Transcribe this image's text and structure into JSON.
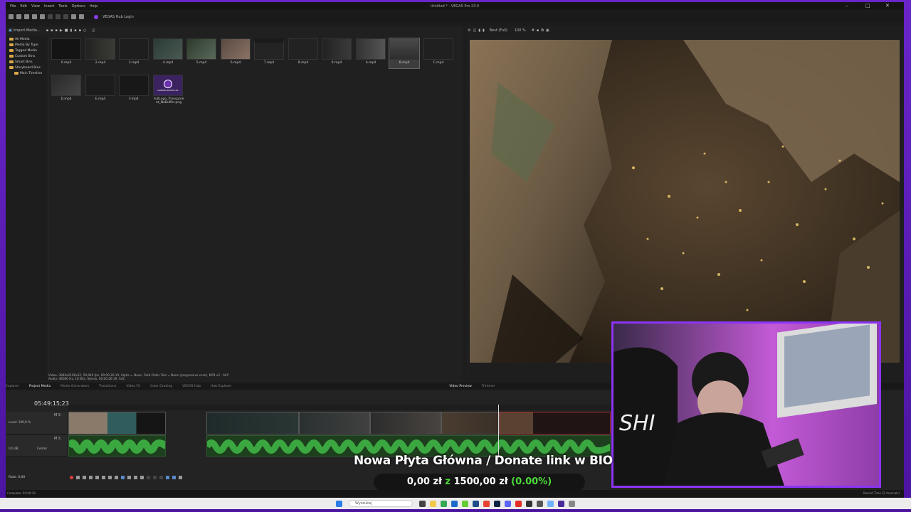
{
  "menu": {
    "items": [
      "File",
      "Edit",
      "View",
      "Insert",
      "Tools",
      "Options",
      "Help"
    ],
    "window_title": "Untitled * - VEGAS Pro 23.0",
    "hub_login": "VEGAS Hub Login"
  },
  "explorer": {
    "import_label": "Import Media...",
    "tree": [
      "All Media",
      "Media By Type",
      "Tagged Media",
      "Custom Bins",
      "Smart Bins",
      "Storyboard Bins",
      "Main Timeline"
    ],
    "media": [
      "0.mp4",
      "2.mp4",
      "3.mp4",
      "4.mp4",
      "5.mp4",
      "6.mp4",
      "7.mp4",
      "8.mp4",
      "9.mp4",
      "A.mp4",
      "B.mp4",
      "C.mp4",
      "D.mp4",
      "E.mp4",
      "F.mp4",
      "FullLogo_Transparent_NoBuffer.png"
    ],
    "info_line1": "Video: 3840x2160x32, 59,940 fps, 00:00:26:19, Alpha = None, Field Order Test = None (progressive scan), MP4 v2 - AVC",
    "info_line2": "Audio: 48000 Hz, 16 Bits, Stereo, 00:00:26:19, AAC",
    "selected": "B.mp4",
    "logo_text": "GAMING RECON #2"
  },
  "preview": {
    "quality": "Best (Full)",
    "zoom": "100 %"
  },
  "tabs": {
    "left": [
      "Explorer",
      "Project Media",
      "Media Generators",
      "Transitions",
      "Video FX",
      "Color Grading",
      "VEGAS Hub",
      "Hub Explorer"
    ],
    "right": [
      "Video Preview",
      "Trimmer"
    ]
  },
  "timeline": {
    "timecode": "05:49:15;23",
    "video_level": "Level: 100,0 %",
    "audio_db": "0,0 dB",
    "audio_pan": "Center",
    "rate": "Rate: 0,00",
    "status_left": "Complete: 00:00:16",
    "status_right": "Record Time (2 channels)"
  },
  "taskbar": {
    "search_placeholder": "Wyszukaj"
  },
  "overlay": {
    "title": "Nowa Płyta Główna / Donate link w BIO",
    "donate_current": "0,00 zł",
    "donate_of": "z",
    "donate_goal": "1500,00 zł",
    "donate_pct": "(0.00%)"
  },
  "colors": {
    "accent_frame": "#6a25c9",
    "webcam_border": "#8c34f5",
    "audio_wave": "#44c24a",
    "donate_green": "#4ddc3a"
  }
}
